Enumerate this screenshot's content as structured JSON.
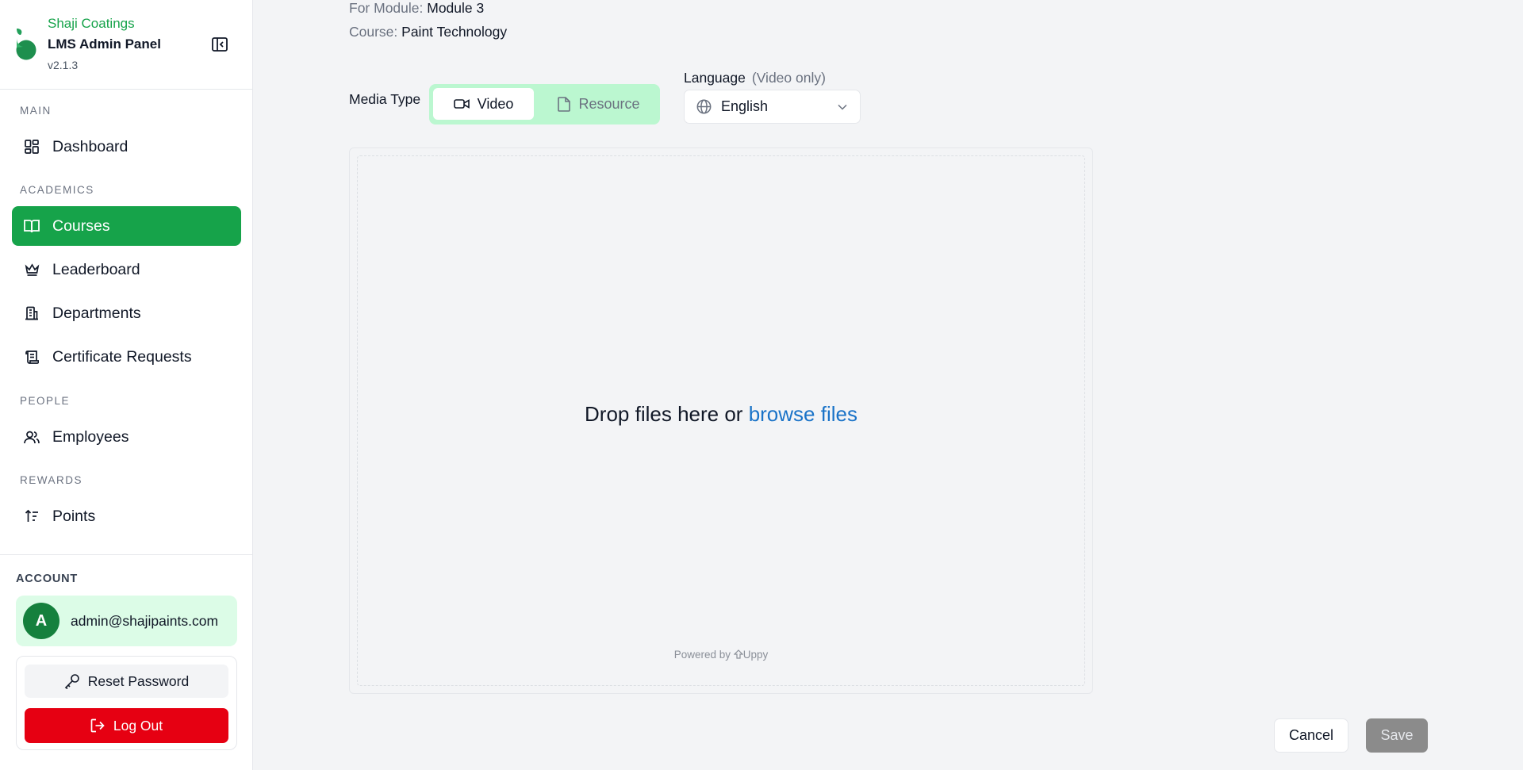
{
  "brand": {
    "company": "Shaji Coatings",
    "panel": "LMS Admin Panel",
    "version": "v2.1.3"
  },
  "nav": {
    "sections": {
      "main": "MAIN",
      "academics": "ACADEMICS",
      "people": "PEOPLE",
      "rewards": "REWARDS"
    },
    "items": {
      "dashboard": "Dashboard",
      "courses": "Courses",
      "leaderboard": "Leaderboard",
      "departments": "Departments",
      "certificates": "Certificate Requests",
      "employees": "Employees",
      "points": "Points"
    },
    "active": "courses"
  },
  "account": {
    "label": "ACCOUNT",
    "avatar_initial": "A",
    "email": "admin@shajipaints.com",
    "reset_label": "Reset Password",
    "logout_label": "Log Out"
  },
  "main": {
    "module_label": "For Module:",
    "module_value": "Module 3",
    "course_label": "Course:",
    "course_value": "Paint Technology",
    "media_type_label": "Media Type",
    "media_options": {
      "video": "Video",
      "resource": "Resource"
    },
    "media_selected": "video",
    "language_label": "Language",
    "language_hint": "(Video only)",
    "language_value": "English",
    "drop_text": "Drop files here or",
    "browse_text": "browse files",
    "powered_by": "Powered by",
    "powered_brand": "Uppy",
    "cancel_label": "Cancel",
    "save_label": "Save"
  },
  "colors": {
    "accent": "#16a34a",
    "accent_light": "#dcfce7",
    "danger": "#e60012",
    "link": "#1a73c8"
  }
}
